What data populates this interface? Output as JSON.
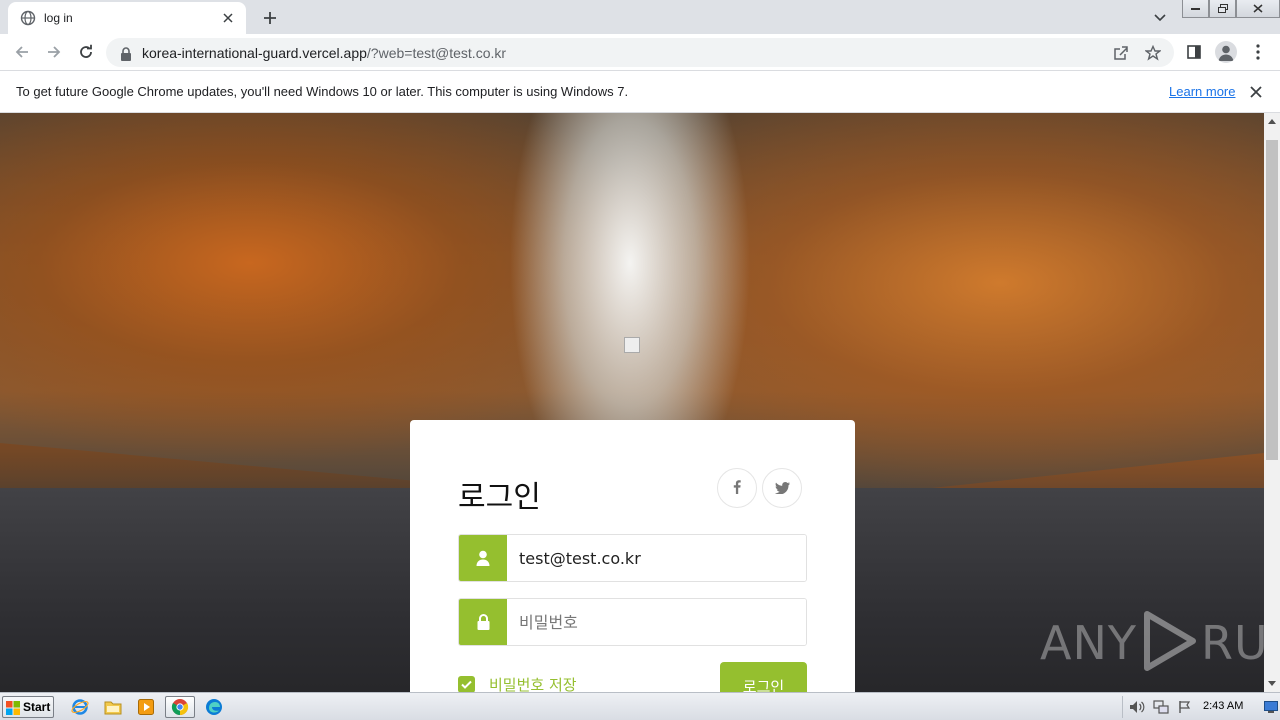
{
  "browser": {
    "tab": {
      "title": "log in"
    },
    "url": {
      "host": "korea-international-guard.vercel.app",
      "path": "/?web=test@test.co.kr"
    }
  },
  "infobar": {
    "message": "To get future Google Chrome updates, you'll need Windows 10 or later. This computer is using Windows 7.",
    "link": "Learn more"
  },
  "login": {
    "title": "로그인",
    "email_value": "test@test.co.kr",
    "password_placeholder": "비밀번호",
    "remember_label": "비밀번호 저장",
    "remember_checked": true,
    "submit_label": "로그인",
    "accent_color": "#95bf2f"
  },
  "social": [
    "facebook-icon",
    "twitter-icon"
  ],
  "watermark": {
    "left": "ANY",
    "right": "RUN"
  },
  "taskbar": {
    "start_label": "Start",
    "apps": [
      "internet-explorer-icon",
      "file-explorer-icon",
      "media-player-icon",
      "chrome-icon",
      "edge-icon"
    ],
    "clock": "2:43 AM"
  }
}
